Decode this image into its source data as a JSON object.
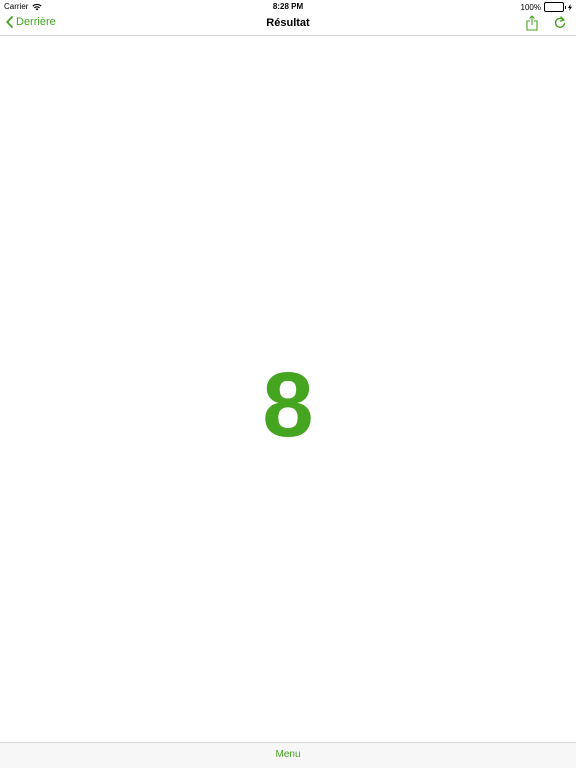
{
  "status_bar": {
    "carrier": "Carrier",
    "time": "8:28 PM",
    "battery_percent": "100%",
    "battery_level": 1.0,
    "battery_color": "#4cd964",
    "icons": [
      "wifi-icon",
      "battery-icon",
      "charging-bolt-icon"
    ]
  },
  "nav": {
    "back_label": "Derrière",
    "title": "Résultat",
    "icons": [
      "chevron-left-icon",
      "share-icon",
      "refresh-icon"
    ]
  },
  "result": {
    "value": "8"
  },
  "toolbar": {
    "menu_label": "Menu"
  },
  "colors": {
    "accent": "#45a520"
  }
}
